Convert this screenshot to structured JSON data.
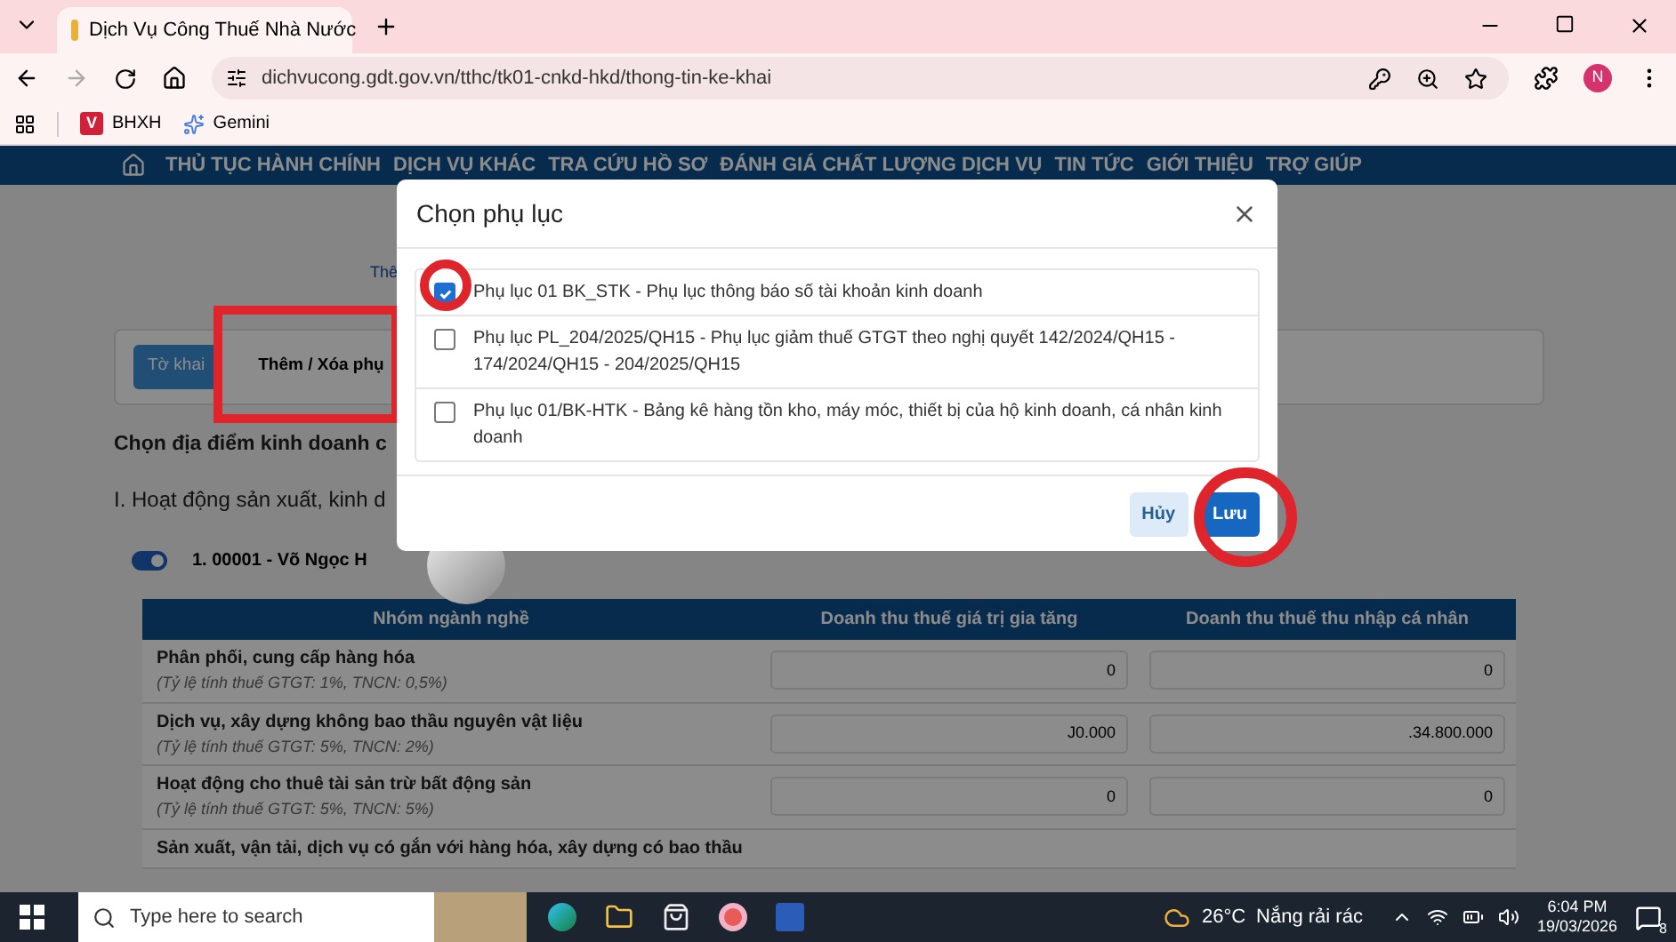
{
  "browser": {
    "tab_title": "Dịch Vụ Công Thuế Nhà Nước",
    "url": "dichvucong.gdt.gov.vn/tthc/tk01-cnkd-hkd/thong-tin-ke-khai",
    "avatar": "N",
    "bookmarks": [
      {
        "label": "BHXH",
        "kind": "letter",
        "badge": "V"
      },
      {
        "label": "Gemini",
        "kind": "star"
      }
    ]
  },
  "nav": {
    "items": [
      "THỦ TỤC HÀNH CHÍNH",
      "DỊCH VỤ KHÁC",
      "TRA CỨU HỒ SƠ",
      "ĐÁNH GIÁ CHẤT LƯỢNG DỊCH VỤ",
      "TIN TỨC",
      "GIỚI THIỆU",
      "TRỢ GIÚP"
    ]
  },
  "page": {
    "link": "Thê",
    "tabs": [
      {
        "label": "Tờ khai",
        "selected": true
      },
      {
        "label": "Thêm / Xóa phụ",
        "selected": false
      }
    ],
    "heading": "Chọn địa điểm kinh doanh c",
    "section": "I. Hoạt động sản xuất, kinh d",
    "business": {
      "label": "1. 00001 - Võ Ngọc H",
      "on": true
    },
    "table": {
      "columns": [
        "Nhóm ngành nghề",
        "Doanh thu thuế giá trị gia tăng",
        "Doanh thu thuế thu nhập cá nhân"
      ],
      "rows": [
        {
          "name": "Phân phối, cung cấp hàng hóa",
          "note": "(Tỷ lệ tính thuế GTGT: 1%, TNCN: 0,5%)",
          "vat": "0",
          "pit": "0"
        },
        {
          "name": "Dịch vụ, xây dựng không bao thầu nguyên vật liệu",
          "note": "(Tỷ lệ tính thuế GTGT: 5%, TNCN: 2%)",
          "vat": "J0.000",
          "pit": ".34.800.000"
        },
        {
          "name": "Hoạt động cho thuê tài sản trừ bất động sản",
          "note": "(Tỷ lệ tính thuế GTGT: 5%, TNCN: 5%)",
          "vat": "0",
          "pit": "0"
        },
        {
          "name": "Sản xuất, vận tải, dịch vụ có gắn với hàng hóa, xây dựng có bao thầu"
        }
      ]
    }
  },
  "modal": {
    "title": "Chọn phụ lục",
    "options": [
      {
        "label": "Phụ lục 01 BK_STK - Phụ lục thông báo số tài khoản kinh doanh",
        "checked": true
      },
      {
        "label": "Phụ lục PL_204/2025/QH15 - Phụ lục giảm thuế GTGT theo nghị quyết 142/2024/QH15 - 174/2024/QH15 - 204/2025/QH15",
        "checked": false
      },
      {
        "label": "Phụ lục 01/BK-HTK - Bảng kê hàng tồn kho, máy móc, thiết bị của hộ kinh doanh, cá nhân kinh doanh",
        "checked": false
      }
    ],
    "cancel": "Hủy",
    "save": "Lưu"
  },
  "taskbar": {
    "search_placeholder": "Type here to search",
    "temperature": "26°C",
    "weather": "Nắng rải rác",
    "time": "6:04 PM",
    "date": "19/03/2026",
    "notifications": "8"
  }
}
